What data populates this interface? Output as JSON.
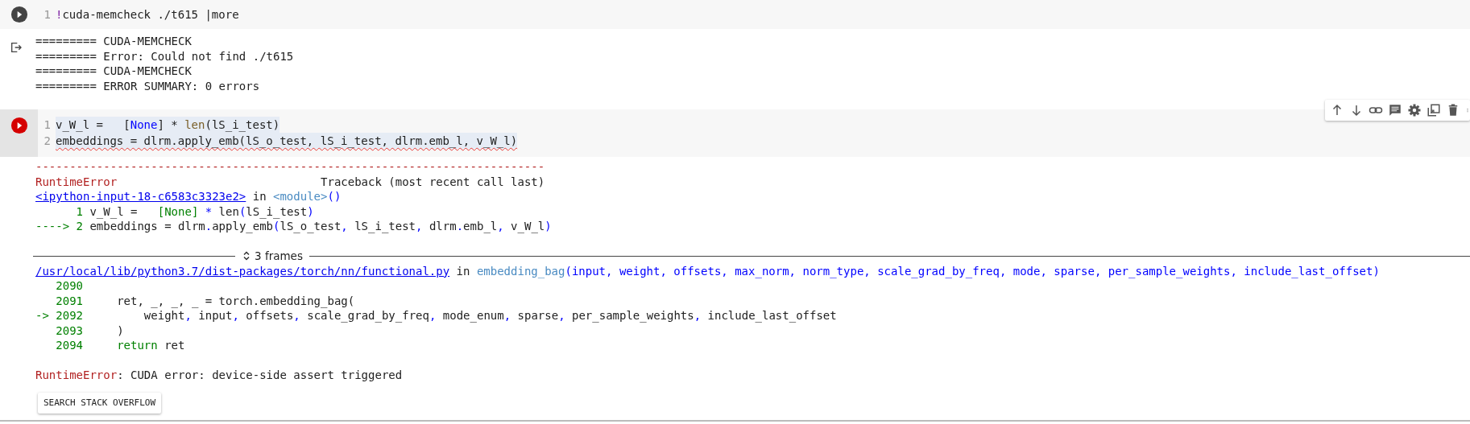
{
  "cells": [
    {
      "error": false,
      "code": [
        {
          "number": "1",
          "error_underline": false,
          "highlighted": false,
          "tokens": [
            {
              "text": "!",
              "kind": "bang"
            },
            {
              "text": "cuda-memcheck ./t615 |more",
              "kind": "plain"
            }
          ]
        }
      ],
      "output": {
        "kind": "stream",
        "lines": [
          {
            "kind": "code",
            "tokens": [
              {
                "text": "========= CUDA-MEMCHECK",
                "kind": "plain"
              }
            ]
          },
          {
            "kind": "code",
            "tokens": [
              {
                "text": "========= Error: Could not find ./t615",
                "kind": "plain"
              }
            ]
          },
          {
            "kind": "code",
            "tokens": [
              {
                "text": "========= CUDA-MEMCHECK",
                "kind": "plain"
              }
            ]
          },
          {
            "kind": "code",
            "tokens": [
              {
                "text": "========= ERROR SUMMARY: 0 errors",
                "kind": "plain"
              }
            ]
          }
        ]
      }
    },
    {
      "error": true,
      "code": [
        {
          "number": "1",
          "error_underline": false,
          "highlighted": true,
          "tokens": [
            {
              "text": "v_W_l =   [",
              "kind": "plain"
            },
            {
              "text": "None",
              "kind": "constblue"
            },
            {
              "text": "] * ",
              "kind": "plain"
            },
            {
              "text": "len",
              "kind": "builtin"
            },
            {
              "text": "(lS_i_test)",
              "kind": "plain"
            }
          ]
        },
        {
          "number": "2",
          "error_underline": true,
          "highlighted": true,
          "tokens": [
            {
              "text": "embeddings = dlrm.apply_emb(lS_o_test, lS_i_test, dlrm.emb_l, v_W_l)",
              "kind": "plain"
            }
          ]
        }
      ],
      "output": {
        "kind": "error",
        "lines": [
          {
            "kind": "code",
            "tokens": [
              {
                "text": "---------------------------------------------------------------------------",
                "kind": "error"
              }
            ]
          },
          {
            "kind": "code",
            "tokens": [
              {
                "text": "RuntimeError",
                "kind": "error"
              },
              {
                "text": "                              Traceback (most recent call last)",
                "kind": "plain"
              }
            ]
          },
          {
            "kind": "code",
            "tokens": [
              {
                "text": "<ipython-input-18-c6583c3323e2>",
                "kind": "link"
              },
              {
                "text": " in ",
                "kind": "plain"
              },
              {
                "text": "<module>",
                "kind": "func"
              },
              {
                "text": "()",
                "kind": "op"
              }
            ]
          },
          {
            "kind": "code",
            "tokens": [
              {
                "text": "      1",
                "kind": "lineno"
              },
              {
                "text": " v_W_l =   ",
                "kind": "plain"
              },
              {
                "text": "[None]",
                "kind": "const"
              },
              {
                "text": " *",
                "kind": "op"
              },
              {
                "text": " len",
                "kind": "plain"
              },
              {
                "text": "(",
                "kind": "op"
              },
              {
                "text": "lS_i_test",
                "kind": "plain"
              },
              {
                "text": ")",
                "kind": "op"
              }
            ]
          },
          {
            "kind": "code",
            "tokens": [
              {
                "text": "----> 2",
                "kind": "lineno"
              },
              {
                "text": " embeddings = dlrm",
                "kind": "plain"
              },
              {
                "text": ".",
                "kind": "op"
              },
              {
                "text": "apply_emb",
                "kind": "plain"
              },
              {
                "text": "(",
                "kind": "op"
              },
              {
                "text": "lS_o_test",
                "kind": "plain"
              },
              {
                "text": ",",
                "kind": "op"
              },
              {
                "text": " lS_i_test",
                "kind": "plain"
              },
              {
                "text": ",",
                "kind": "op"
              },
              {
                "text": " dlrm",
                "kind": "plain"
              },
              {
                "text": ".",
                "kind": "op"
              },
              {
                "text": "emb_l",
                "kind": "plain"
              },
              {
                "text": ",",
                "kind": "op"
              },
              {
                "text": " v_W_l",
                "kind": "plain"
              },
              {
                "text": ")",
                "kind": "op"
              }
            ]
          },
          {
            "kind": "blank"
          },
          {
            "kind": "frames",
            "label": "3 frames"
          },
          {
            "kind": "code",
            "tokens": [
              {
                "text": "/usr/local/lib/python3.7/dist-packages/torch/nn/functional.py",
                "kind": "link"
              },
              {
                "text": " in ",
                "kind": "plain"
              },
              {
                "text": "embedding_bag",
                "kind": "func"
              },
              {
                "text": "(input, weight, offsets, max_norm, norm_type, scale_grad_by_freq, mode, sparse, per_sample_weights, include_last_offset)",
                "kind": "op"
              }
            ]
          },
          {
            "kind": "code",
            "tokens": [
              {
                "text": "   2090",
                "kind": "lineno"
              }
            ]
          },
          {
            "kind": "code",
            "tokens": [
              {
                "text": "   2091",
                "kind": "lineno"
              },
              {
                "text": "     ret, _, _, _ = torch.embedding_bag(",
                "kind": "plain"
              }
            ]
          },
          {
            "kind": "code",
            "tokens": [
              {
                "text": "-> 2092",
                "kind": "lineno"
              },
              {
                "text": "         weight",
                "kind": "plain"
              },
              {
                "text": ",",
                "kind": "op"
              },
              {
                "text": " input",
                "kind": "plain"
              },
              {
                "text": ",",
                "kind": "op"
              },
              {
                "text": " offsets",
                "kind": "plain"
              },
              {
                "text": ",",
                "kind": "op"
              },
              {
                "text": " scale_grad_by_freq",
                "kind": "plain"
              },
              {
                "text": ",",
                "kind": "op"
              },
              {
                "text": " mode_enum",
                "kind": "plain"
              },
              {
                "text": ",",
                "kind": "op"
              },
              {
                "text": " sparse",
                "kind": "plain"
              },
              {
                "text": ",",
                "kind": "op"
              },
              {
                "text": " per_sample_weights",
                "kind": "plain"
              },
              {
                "text": ",",
                "kind": "op"
              },
              {
                "text": " include_last_offset",
                "kind": "plain"
              }
            ]
          },
          {
            "kind": "code",
            "tokens": [
              {
                "text": "   2093",
                "kind": "lineno"
              },
              {
                "text": "     )",
                "kind": "plain"
              }
            ]
          },
          {
            "kind": "code",
            "tokens": [
              {
                "text": "   2094",
                "kind": "lineno"
              },
              {
                "text": "     return",
                "kind": "kw"
              },
              {
                "text": " ret",
                "kind": "plain"
              }
            ]
          },
          {
            "kind": "blank"
          },
          {
            "kind": "code",
            "tokens": [
              {
                "text": "RuntimeError",
                "kind": "error"
              },
              {
                "text": ": CUDA error: device-side assert triggered",
                "kind": "plain"
              }
            ]
          }
        ],
        "button": "SEARCH STACK OVERFLOW"
      }
    }
  ]
}
